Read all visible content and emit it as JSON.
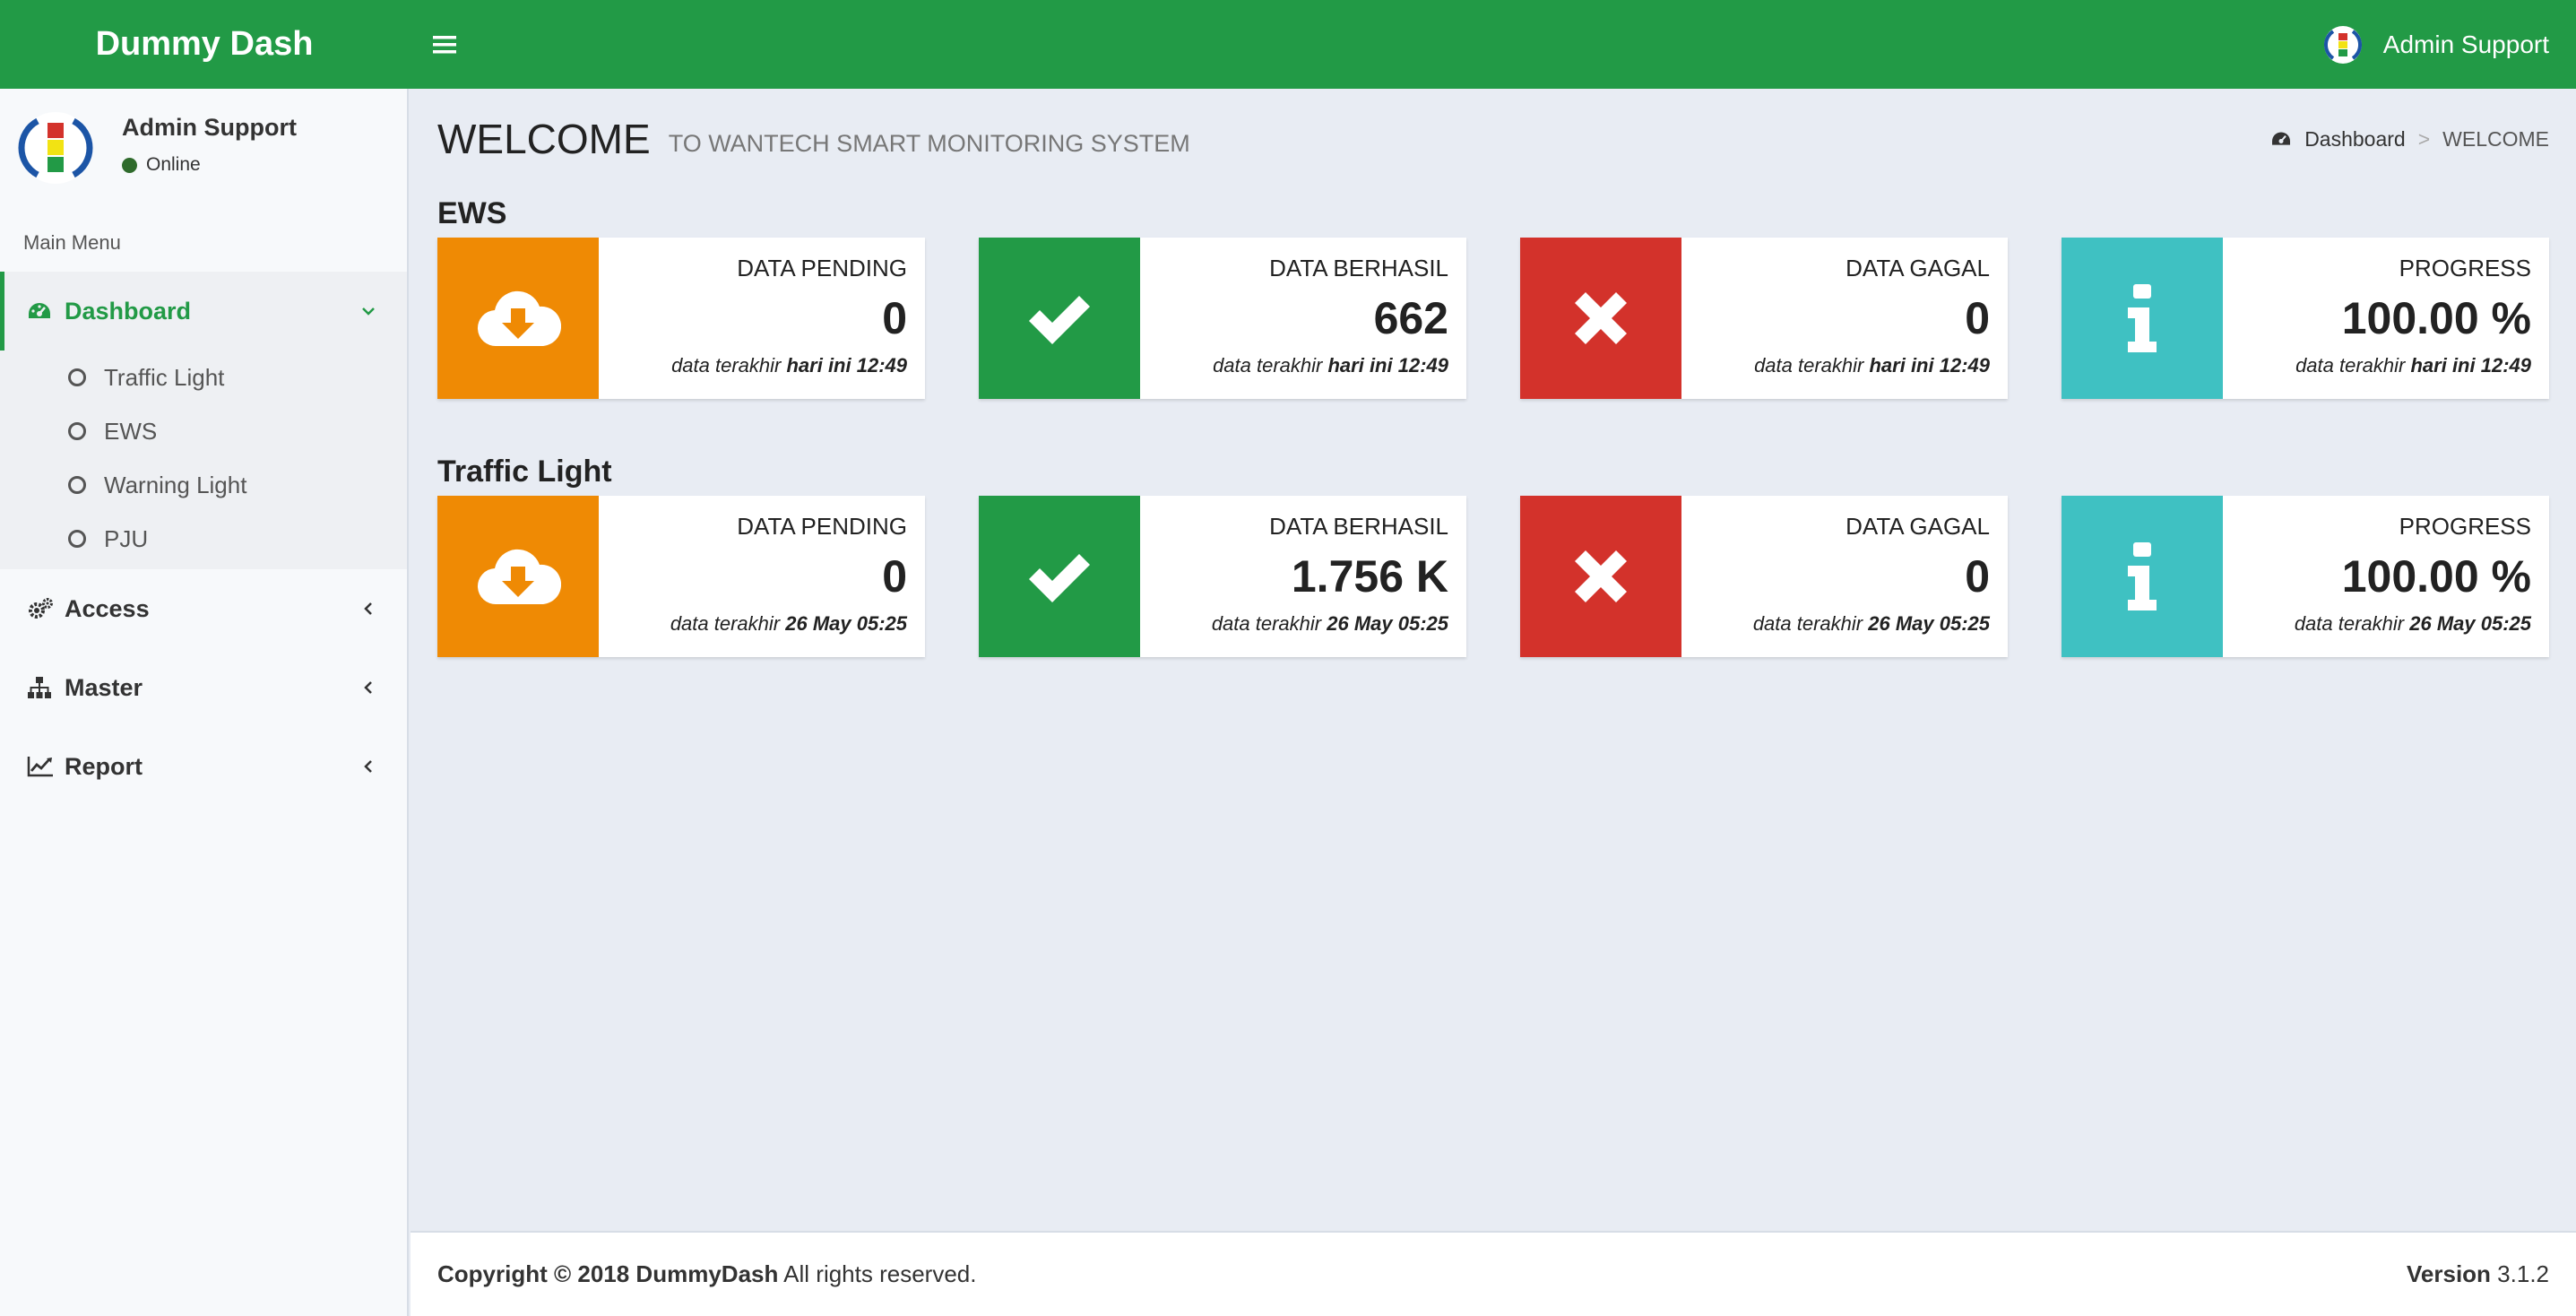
{
  "header": {
    "brand": "Dummy Dash",
    "user_name": "Admin Support"
  },
  "sidebar": {
    "user_name": "Admin Support",
    "status": "Online",
    "menu_header": "Main Menu",
    "dashboard": {
      "label": "Dashboard",
      "subitems": [
        "Traffic Light",
        "EWS",
        "Warning Light",
        "PJU"
      ]
    },
    "access": "Access",
    "master": "Master",
    "report": "Report"
  },
  "content": {
    "title": "WELCOME",
    "subtitle": "TO WANTECH SMART MONITORING SYSTEM",
    "breadcrumb": {
      "home": "Dashboard",
      "separator": ">",
      "current": "WELCOME"
    }
  },
  "sections": [
    {
      "title": "EWS",
      "boxes": [
        {
          "label": "DATA PENDING",
          "value": "0",
          "foot_prefix": "data terakhir",
          "foot_time": "hari ini 12:49",
          "icon": "cloud-download-icon",
          "color": "#ef8a04"
        },
        {
          "label": "DATA BERHASIL",
          "value": "662",
          "foot_prefix": "data terakhir",
          "foot_time": "hari ini 12:49",
          "icon": "check-icon",
          "color": "#229a46"
        },
        {
          "label": "DATA GAGAL",
          "value": "0",
          "foot_prefix": "data terakhir",
          "foot_time": "hari ini 12:49",
          "icon": "times-icon",
          "color": "#d3322b"
        },
        {
          "label": "PROGRESS",
          "value": "100.00 %",
          "foot_prefix": "data terakhir",
          "foot_time": "hari ini 12:49",
          "icon": "info-icon",
          "color": "#3fc1c2"
        }
      ]
    },
    {
      "title": "Traffic Light",
      "boxes": [
        {
          "label": "DATA PENDING",
          "value": "0",
          "foot_prefix": "data terakhir",
          "foot_time": "26 May 05:25",
          "icon": "cloud-download-icon",
          "color": "#ef8a04"
        },
        {
          "label": "DATA BERHASIL",
          "value": "1.756 K",
          "foot_prefix": "data terakhir",
          "foot_time": "26 May 05:25",
          "icon": "check-icon",
          "color": "#229a46"
        },
        {
          "label": "DATA GAGAL",
          "value": "0",
          "foot_prefix": "data terakhir",
          "foot_time": "26 May 05:25",
          "icon": "times-icon",
          "color": "#d3322b"
        },
        {
          "label": "PROGRESS",
          "value": "100.00 %",
          "foot_prefix": "data terakhir",
          "foot_time": "26 May 05:25",
          "icon": "info-icon",
          "color": "#3fc1c2"
        }
      ]
    }
  ],
  "footer": {
    "copyright_bold": "Copyright © 2018 DummyDash",
    "copyright_rest": "All rights reserved.",
    "version_label": "Version",
    "version_value": "3.1.2"
  },
  "colors": {
    "brand": "#229a46",
    "orange": "#ef8a04",
    "red": "#d3322b",
    "teal": "#3fc1c2"
  }
}
